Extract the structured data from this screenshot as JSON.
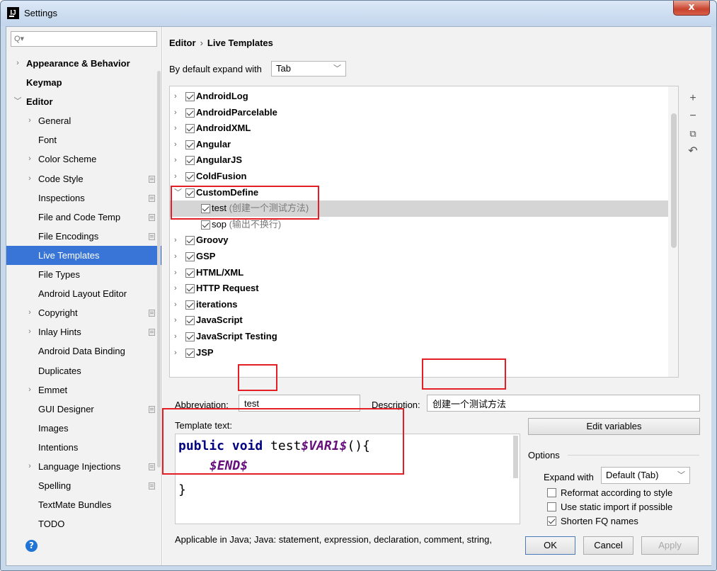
{
  "window": {
    "title": "Settings",
    "close_symbol": "x"
  },
  "search": {
    "placeholder": "",
    "value": ""
  },
  "sidebar": {
    "items": [
      {
        "label": "Appearance & Behavior",
        "arrow": ">",
        "bold": true,
        "level": 0
      },
      {
        "label": "Keymap",
        "arrow": "",
        "bold": true,
        "level": 0
      },
      {
        "label": "Editor",
        "arrow": "v",
        "bold": true,
        "level": 0
      },
      {
        "label": "General",
        "arrow": ">",
        "level": 1
      },
      {
        "label": "Font",
        "arrow": "",
        "level": 1
      },
      {
        "label": "Color Scheme",
        "arrow": ">",
        "level": 1
      },
      {
        "label": "Code Style",
        "arrow": ">",
        "level": 1,
        "project_icon": true
      },
      {
        "label": "Inspections",
        "arrow": "",
        "level": 1,
        "project_icon": true
      },
      {
        "label": "File and Code Temp",
        "arrow": "",
        "level": 1,
        "project_icon": true
      },
      {
        "label": "File Encodings",
        "arrow": "",
        "level": 1,
        "project_icon": true
      },
      {
        "label": "Live Templates",
        "arrow": "",
        "level": 1,
        "selected": true
      },
      {
        "label": "File Types",
        "arrow": "",
        "level": 1
      },
      {
        "label": "Android Layout Editor",
        "arrow": "",
        "level": 1
      },
      {
        "label": "Copyright",
        "arrow": ">",
        "level": 1,
        "project_icon": true
      },
      {
        "label": "Inlay Hints",
        "arrow": ">",
        "level": 1,
        "project_icon": true
      },
      {
        "label": "Android Data Binding",
        "arrow": "",
        "level": 1
      },
      {
        "label": "Duplicates",
        "arrow": "",
        "level": 1
      },
      {
        "label": "Emmet",
        "arrow": ">",
        "level": 1
      },
      {
        "label": "GUI Designer",
        "arrow": "",
        "level": 1,
        "project_icon": true
      },
      {
        "label": "Images",
        "arrow": "",
        "level": 1
      },
      {
        "label": "Intentions",
        "arrow": "",
        "level": 1
      },
      {
        "label": "Language Injections",
        "arrow": ">",
        "level": 1,
        "project_icon": true
      },
      {
        "label": "Spelling",
        "arrow": "",
        "level": 1,
        "project_icon": true
      },
      {
        "label": "TextMate Bundles",
        "arrow": "",
        "level": 1
      },
      {
        "label": "TODO",
        "arrow": "",
        "level": 1
      }
    ]
  },
  "breadcrumb": {
    "parent": "Editor",
    "separator": "›",
    "current": "Live Templates"
  },
  "expand": {
    "label": "By default expand with",
    "value": "Tab"
  },
  "templates": [
    {
      "name": "AndroidLog",
      "expanded": false,
      "checked": true
    },
    {
      "name": "AndroidParcelable",
      "expanded": false,
      "checked": true
    },
    {
      "name": "AndroidXML",
      "expanded": false,
      "checked": true
    },
    {
      "name": "Angular",
      "expanded": false,
      "checked": true
    },
    {
      "name": "AngularJS",
      "expanded": false,
      "checked": true
    },
    {
      "name": "ColdFusion",
      "expanded": false,
      "checked": true
    },
    {
      "name": "CustomDefine",
      "expanded": true,
      "checked": true
    },
    {
      "name": "test",
      "desc": "(创建一个测试方法)",
      "child": true,
      "checked": true,
      "highlight": true
    },
    {
      "name": "sop",
      "desc": "(输出不换行)",
      "child": true,
      "checked": true
    },
    {
      "name": "Groovy",
      "expanded": false,
      "checked": true
    },
    {
      "name": "GSP",
      "expanded": false,
      "checked": true
    },
    {
      "name": "HTML/XML",
      "expanded": false,
      "checked": true
    },
    {
      "name": "HTTP Request",
      "expanded": false,
      "checked": true
    },
    {
      "name": "iterations",
      "expanded": false,
      "checked": true
    },
    {
      "name": "JavaScript",
      "expanded": false,
      "checked": true
    },
    {
      "name": "JavaScript Testing",
      "expanded": false,
      "checked": true
    },
    {
      "name": "JSP",
      "expanded": false,
      "checked": true
    }
  ],
  "tools": {
    "add": "+",
    "remove": "−",
    "copy": "⧉",
    "restore": "↶"
  },
  "form": {
    "abbreviation_label": "Abbreviation:",
    "abbreviation_value": "test",
    "description_label": "Description:",
    "description_value": "创建一个测试方法",
    "template_text_label": "Template text:",
    "code": {
      "line1_kw": "public void",
      "line1_name": " test",
      "line1_var": "$VAR1$",
      "line1_tail": "(){",
      "line2_var": "$END$",
      "line3": "}"
    },
    "applicable": "Applicable in Java; Java: statement, expression, declaration, comment, string,"
  },
  "options": {
    "edit_variables": "Edit variables",
    "title": "Options",
    "expand_with_label": "Expand with",
    "expand_with_value": "Default (Tab)",
    "reformat": {
      "label": "Reformat according to style",
      "checked": false
    },
    "static_import": {
      "label": "Use static import if possible",
      "checked": false
    },
    "shorten_fq": {
      "label": "Shorten FQ names",
      "checked": true
    }
  },
  "buttons": {
    "ok": "OK",
    "cancel": "Cancel",
    "apply": "Apply"
  },
  "colors": {
    "selection": "#3875d7",
    "annotation": "#e31e24",
    "keyword": "#000080",
    "template_var": "#660e7a"
  }
}
